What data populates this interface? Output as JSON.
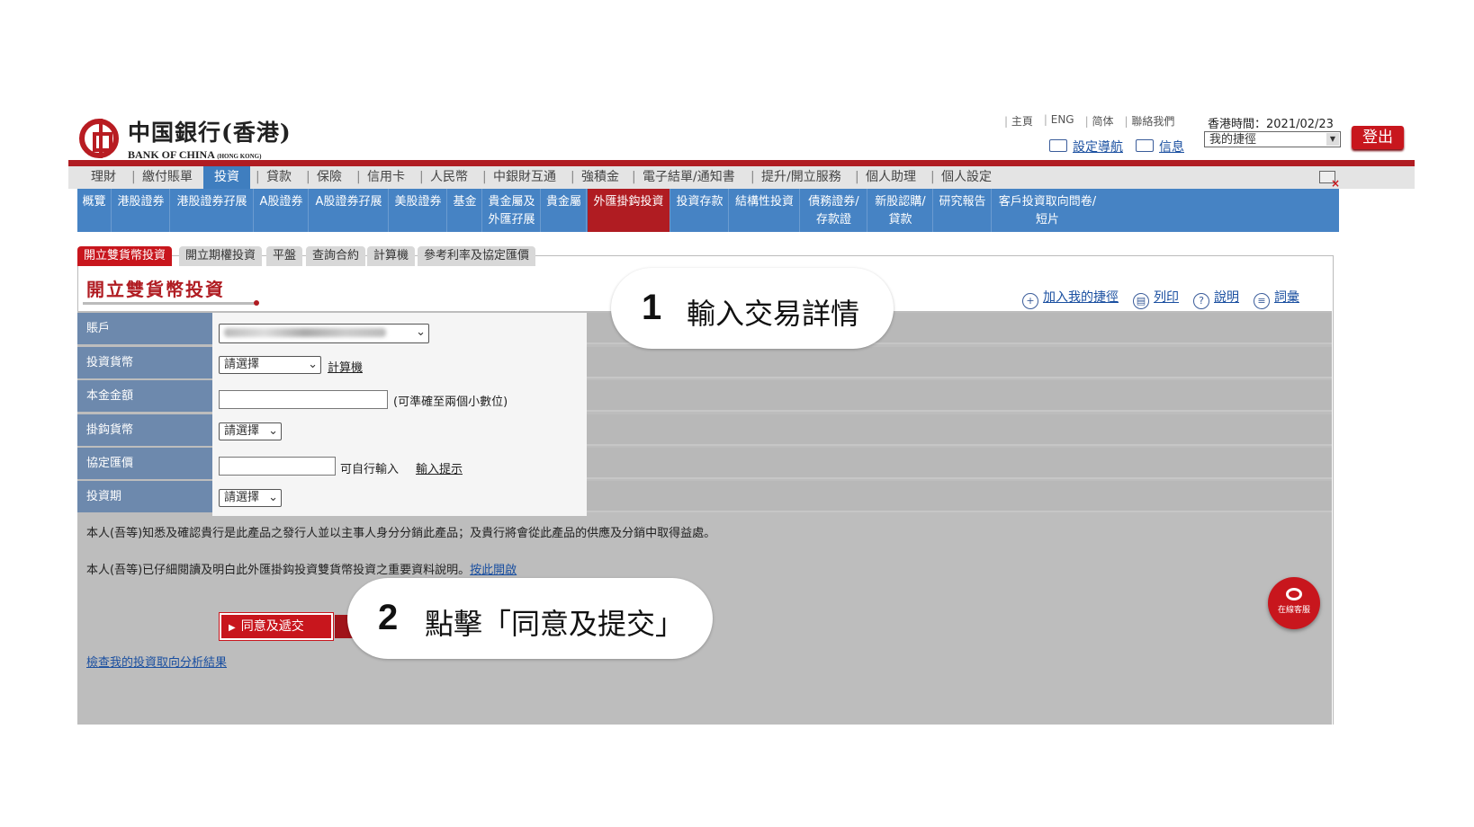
{
  "header": {
    "logo_cn": "中国銀行(香港)",
    "logo_en": "BANK OF CHINA",
    "logo_en_suffix": "(HONG KONG)",
    "top_links": [
      "主頁",
      "ENG",
      "简体",
      "聯絡我們"
    ],
    "hk_time": "香港時間：2021/02/23",
    "logout_label": "登出",
    "nav_setting_label": "設定導航",
    "message_label": "信息",
    "shortcut_select": "我的捷徑"
  },
  "main_nav": [
    "理財",
    "繳付賬單",
    "投資",
    "貸款",
    "保險",
    "信用卡",
    "人民幣",
    "中銀財互通",
    "強積金",
    "電子結單/通知書",
    "提升/開立服務",
    "個人助理",
    "個人設定"
  ],
  "main_nav_active": "投資",
  "sub_nav": [
    "概覽",
    "港股證券",
    "港股證券孖展",
    "A股證券",
    "A股證券孖展",
    "美股證券",
    "基金",
    "貴金屬及",
    "外匯孖展",
    "貴金屬",
    "外匯掛鈎投資",
    "投資存款",
    "結構性投資",
    "債務證券/",
    "存款證",
    "新股認購/",
    "貸款",
    "研究報告",
    "客戶投資取向問卷/",
    "短片"
  ],
  "sub_nav_active": "外匯掛鈎投資",
  "form_tabs": [
    "開立雙貨幣投資",
    "開立期權投資",
    "平盤",
    "查詢合約",
    "計算機",
    "參考利率及協定匯價"
  ],
  "page_title": "開立雙貨幣投資",
  "actions": [
    "加入我的捷徑",
    "列印",
    "說明",
    "詞彙"
  ],
  "form": {
    "account_label": "賬戶",
    "currency_label": "投資貨幣",
    "currency_value": "請選擇",
    "calculator_link": "計算機",
    "principal_label": "本金金額",
    "principal_hint": "(可準確至兩個小數位)",
    "linked_label": "掛鈎貨幣",
    "linked_value": "請選擇",
    "rate_label": "協定匯價",
    "rate_hint": "可自行輸入",
    "input_tip_link": "輸入提示",
    "tenor_label": "投資期",
    "tenor_value": "請選擇"
  },
  "notice1": "本人(吾等)知悉及確認貴行是此產品之發行人並以主事人身分分銷此產品；及貴行將會從此產品的供應及分銷中取得益處。",
  "notice2": "本人(吾等)已仔細閱讀及明白此外匯掛鈎投資雙貨幣投資之重要資料說明。",
  "notice2_link": "按此開啟",
  "agree_button": "同意及遞交",
  "risk_link": "檢查我的投資取向分析結果",
  "chat_label": "在線客服",
  "callout1": {
    "num": "1",
    "text": "輸入交易詳情"
  },
  "callout2": {
    "num": "2",
    "text": "點擊「同意及提交」"
  }
}
